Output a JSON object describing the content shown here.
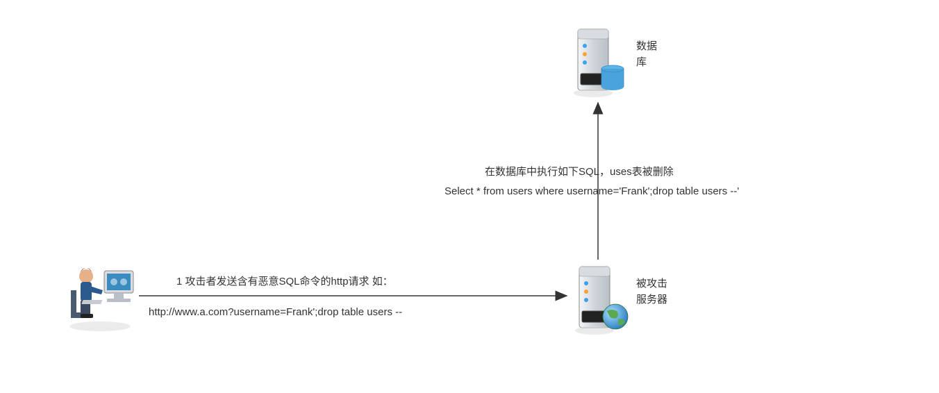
{
  "nodes": {
    "database": {
      "label_line1": "数据",
      "label_line2": "库"
    },
    "server": {
      "label_line1": "被攻击",
      "label_line2": "服务器"
    }
  },
  "arrows": {
    "attacker_to_server": {
      "label_top": "1 攻击者发送含有恶意SQL命令的http请求 如：",
      "label_bottom": "http://www.a.com?username=Frank';drop table users --"
    },
    "server_to_database": {
      "label_top": "在数据库中执行如下SQL，uses表被删除",
      "label_bottom": "Select * from users where username='Frank';drop table users --'"
    }
  }
}
